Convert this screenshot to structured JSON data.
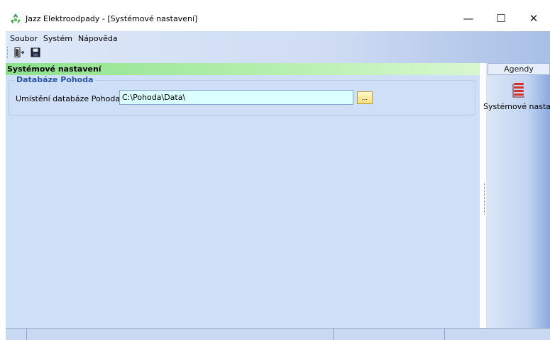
{
  "window": {
    "title": "Jazz Elektroodpady - [Systémové nastavení]",
    "minimize_glyph": "—",
    "maximize_glyph": "☐",
    "close_glyph": "✕"
  },
  "menu": {
    "items": [
      "Soubor",
      "Systém",
      "Nápověda"
    ]
  },
  "toolbar": {
    "icons": [
      "exit-door-icon",
      "save-disk-icon"
    ]
  },
  "panel": {
    "title": "Systémové nastavení",
    "group_title": "Databáze Pohoda",
    "field_label": "Umístění databáze Pohoda",
    "field_value": "C:\\Pohoda\\Data\\",
    "browse_label": "..."
  },
  "agenda": {
    "header": "Agendy",
    "items": [
      {
        "label": "Systémové nastavení",
        "icon": "settings-list-icon"
      }
    ]
  },
  "statusbar": {
    "segments": [
      "",
      "",
      "",
      ""
    ]
  },
  "colors": {
    "panel_header_green": "#8de28c",
    "group_title_blue": "#2b55a8",
    "input_bg": "#dcffff",
    "main_bg": "#cfdff7",
    "accent_red": "#d0332c"
  }
}
